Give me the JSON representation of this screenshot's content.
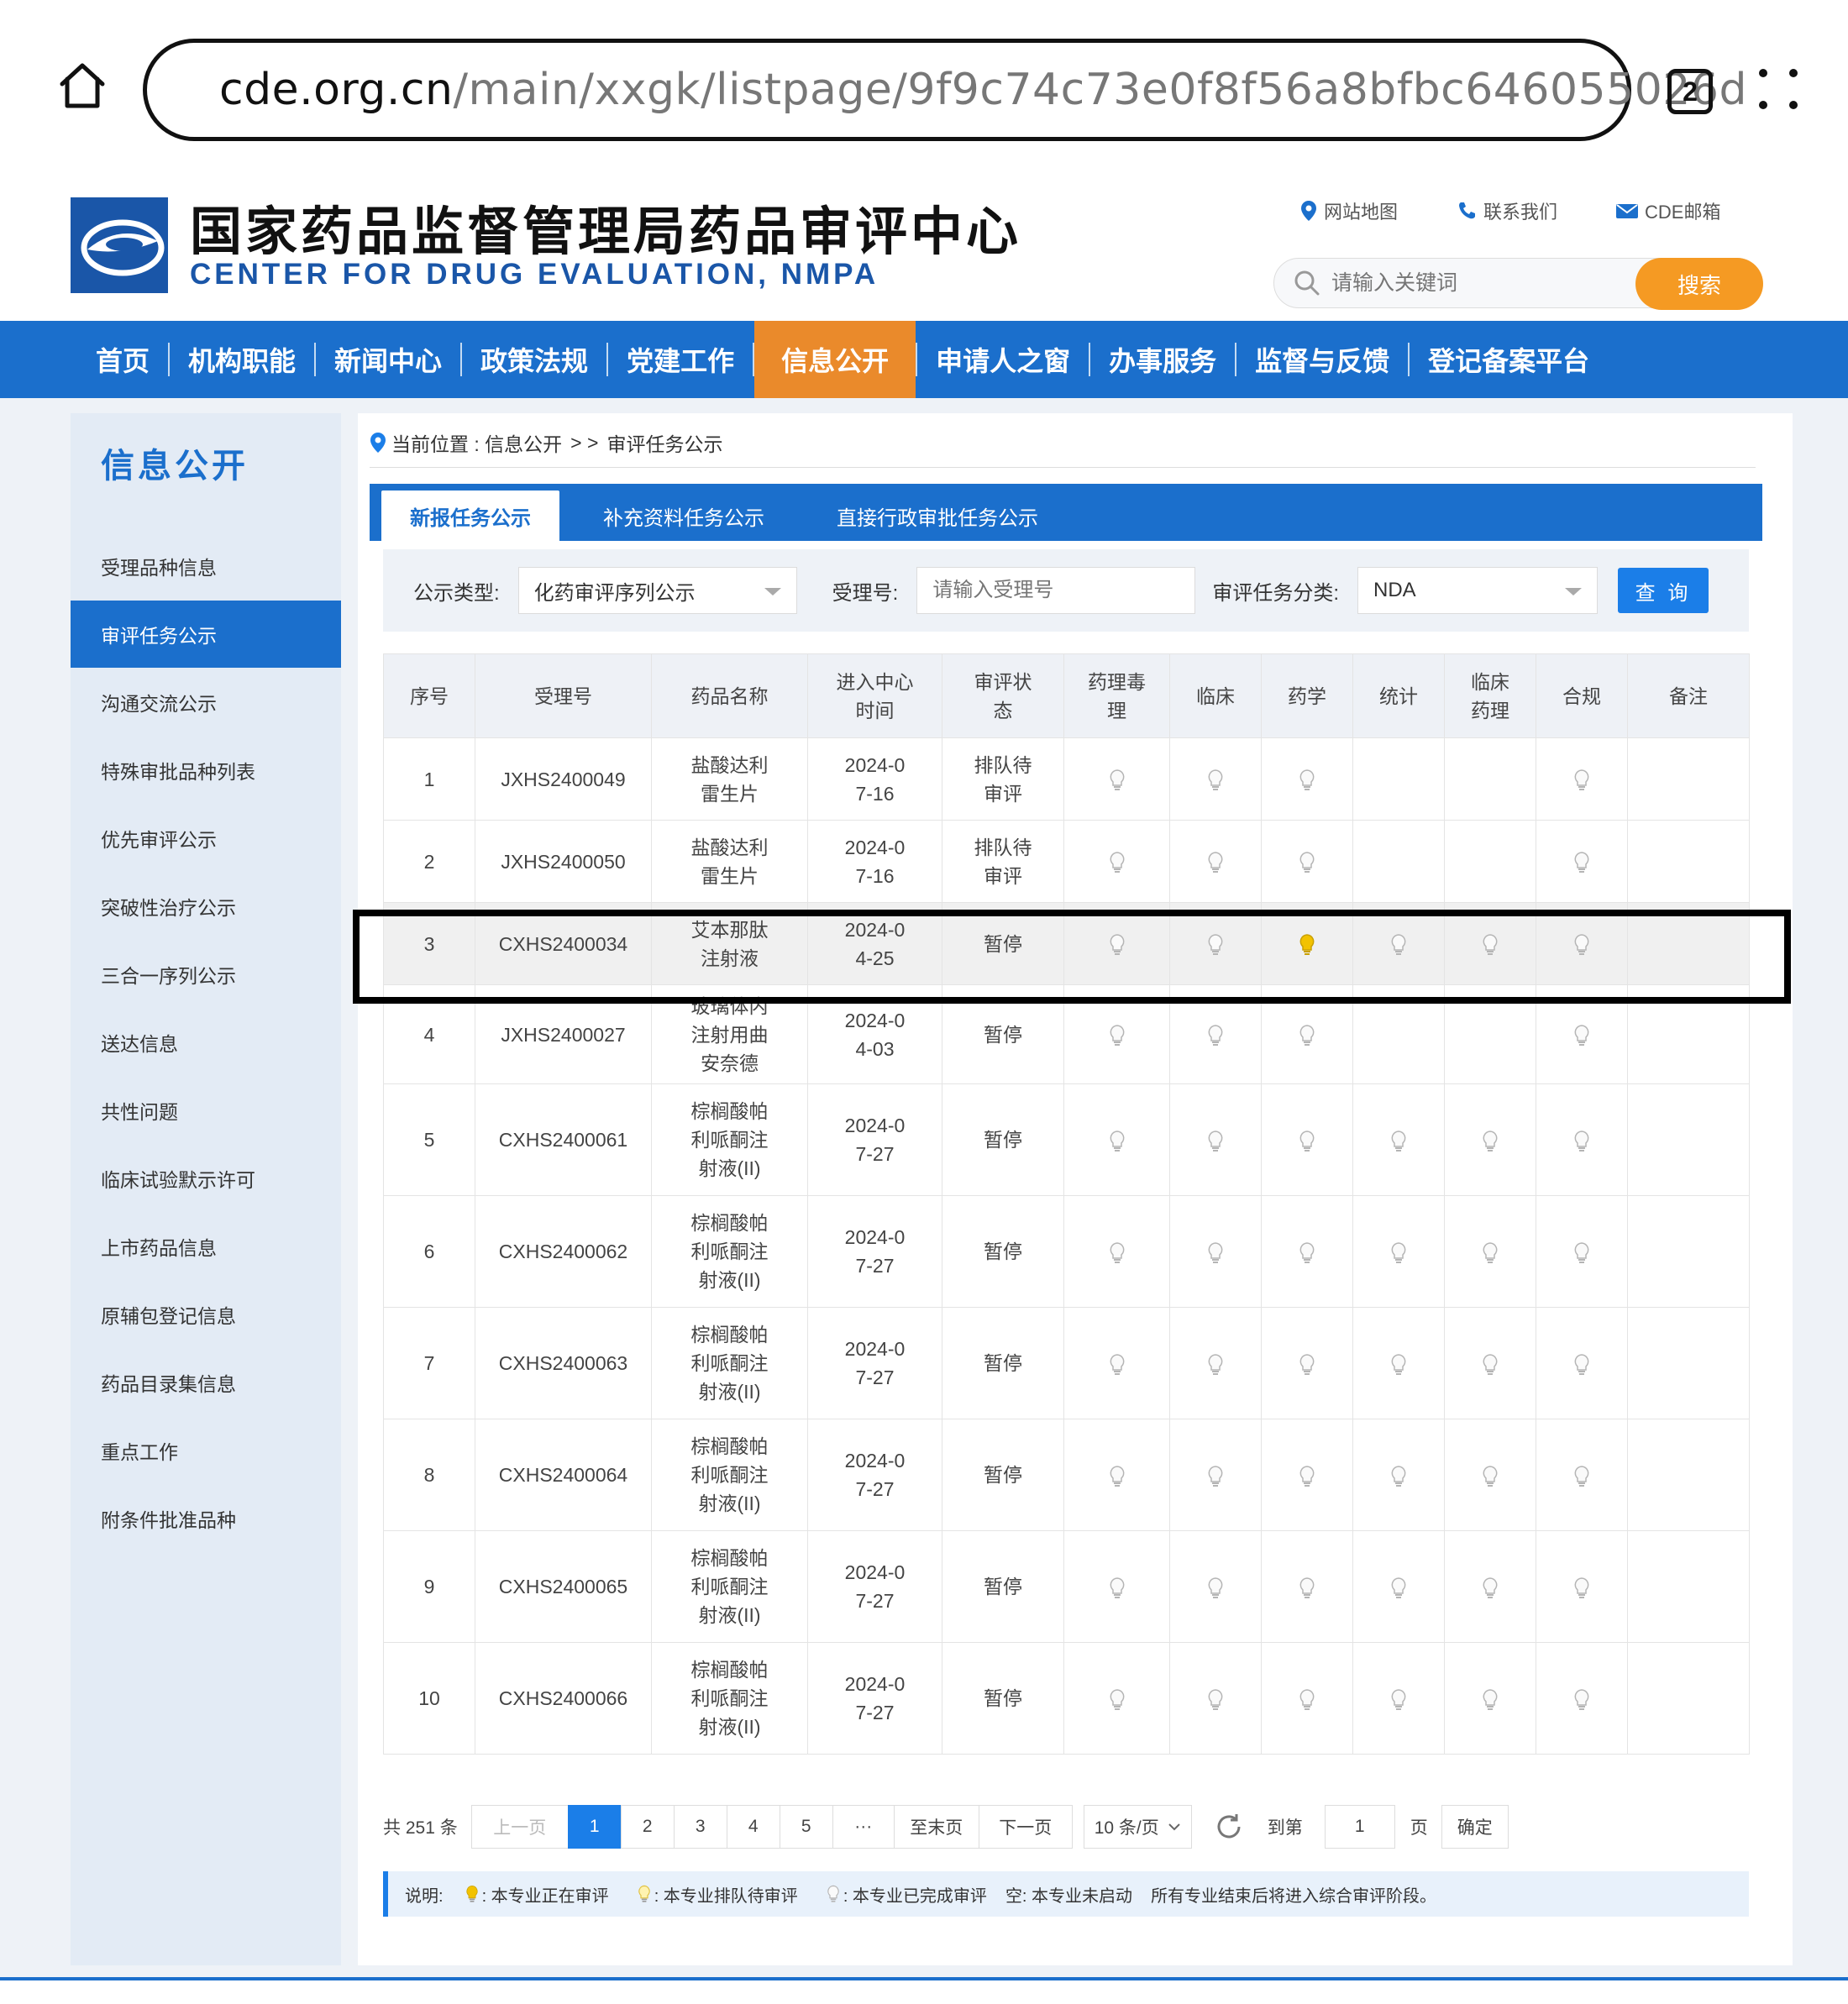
{
  "browser": {
    "url_host": "cde.org.cn",
    "url_path": "/main/xxgk/listpage/9f9c74c73e0f8f56a8bfbc646055026d",
    "tab_count": "2"
  },
  "header": {
    "title": "国家药品监督管理局药品审评中心",
    "subtitle": "CENTER FOR DRUG EVALUATION, NMPA",
    "links": [
      "网站地图",
      "联系我们",
      "CDE邮箱"
    ],
    "search_placeholder": "请输入关键词",
    "search_button": "搜索"
  },
  "nav": {
    "items": [
      "首页",
      "机构职能",
      "新闻中心",
      "政策法规",
      "党建工作",
      "信息公开",
      "申请人之窗",
      "办事服务",
      "监督与反馈",
      "登记备案平台"
    ],
    "active": "信息公开"
  },
  "sidebar": {
    "title": "信息公开",
    "items": [
      "受理品种信息",
      "审评任务公示",
      "沟通交流公示",
      "特殊审批品种列表",
      "优先审评公示",
      "突破性治疗公示",
      "三合一序列公示",
      "送达信息",
      "共性问题",
      "临床试验默示许可",
      "上市药品信息",
      "原辅包登记信息",
      "药品目录集信息",
      "重点工作",
      "附条件批准品种"
    ],
    "active": "审评任务公示"
  },
  "breadcrumb": {
    "prefix": "当前位置 : 信息公开",
    "sep": "> >",
    "current": "审评任务公示"
  },
  "tabs": [
    "新报任务公示",
    "补充资料任务公示",
    "直接行政审批任务公示"
  ],
  "filter": {
    "type_label": "公示类型:",
    "type_value": "化药审评序列公示",
    "accept_label": "受理号:",
    "accept_placeholder": "请输入受理号",
    "category_label": "审评任务分类:",
    "category_value": "NDA",
    "query_button": "查 询"
  },
  "table": {
    "headers": [
      "序号",
      "受理号",
      "药品名称",
      "进入中心时间",
      "审评状态",
      "药理毒理",
      "临床",
      "药学",
      "统计",
      "临床药理",
      "合规",
      "备注"
    ],
    "rows": [
      {
        "no": "1",
        "id": "JXHS2400049",
        "name": "盐酸达利雷生片",
        "date": "2024-07-16",
        "status": "排队待审评",
        "flags": [
          "done",
          "done",
          "done",
          "",
          "",
          "done"
        ],
        "note": ""
      },
      {
        "no": "2",
        "id": "JXHS2400050",
        "name": "盐酸达利雷生片",
        "date": "2024-07-16",
        "status": "排队待审评",
        "flags": [
          "done",
          "done",
          "done",
          "",
          "",
          "done"
        ],
        "note": ""
      },
      {
        "no": "3",
        "id": "CXHS2400034",
        "name": "艾本那肽注射液",
        "date": "2024-04-25",
        "status": "暂停",
        "flags": [
          "done",
          "done",
          "active",
          "done",
          "done",
          "done"
        ],
        "note": ""
      },
      {
        "no": "4",
        "id": "JXHS2400027",
        "name": "玻璃体内注射用曲安奈德",
        "date": "2024-04-03",
        "status": "暂停",
        "flags": [
          "done",
          "done",
          "done",
          "",
          "",
          "done"
        ],
        "note": ""
      },
      {
        "no": "5",
        "id": "CXHS2400061",
        "name": "棕榈酸帕利哌酮注射液(II)",
        "date": "2024-07-27",
        "status": "暂停",
        "flags": [
          "done",
          "done",
          "done",
          "done",
          "done",
          "done"
        ],
        "note": ""
      },
      {
        "no": "6",
        "id": "CXHS2400062",
        "name": "棕榈酸帕利哌酮注射液(II)",
        "date": "2024-07-27",
        "status": "暂停",
        "flags": [
          "done",
          "done",
          "done",
          "done",
          "done",
          "done"
        ],
        "note": ""
      },
      {
        "no": "7",
        "id": "CXHS2400063",
        "name": "棕榈酸帕利哌酮注射液(II)",
        "date": "2024-07-27",
        "status": "暂停",
        "flags": [
          "done",
          "done",
          "done",
          "done",
          "done",
          "done"
        ],
        "note": ""
      },
      {
        "no": "8",
        "id": "CXHS2400064",
        "name": "棕榈酸帕利哌酮注射液(II)",
        "date": "2024-07-27",
        "status": "暂停",
        "flags": [
          "done",
          "done",
          "done",
          "done",
          "done",
          "done"
        ],
        "note": ""
      },
      {
        "no": "9",
        "id": "CXHS2400065",
        "name": "棕榈酸帕利哌酮注射液(II)",
        "date": "2024-07-27",
        "status": "暂停",
        "flags": [
          "done",
          "done",
          "done",
          "done",
          "done",
          "done"
        ],
        "note": ""
      },
      {
        "no": "10",
        "id": "CXHS2400066",
        "name": "棕榈酸帕利哌酮注射液(II)",
        "date": "2024-07-27",
        "status": "暂停",
        "flags": [
          "done",
          "done",
          "done",
          "done",
          "done",
          "done"
        ],
        "note": ""
      }
    ]
  },
  "pager": {
    "total": "共 251 条",
    "prev": "上一页",
    "pages": [
      "1",
      "2",
      "3",
      "4",
      "5",
      "···"
    ],
    "current": "1",
    "last": "至末页",
    "next": "下一页",
    "size": "10 条/页",
    "goto_label": "到第",
    "goto_value": "1",
    "page_label": "页",
    "confirm": "确定"
  },
  "legend": {
    "title": "说明:",
    "active": ": 本专业正在审评",
    "queued": ": 本专业排队待审评",
    "done": ": 本专业已完成审评",
    "empty": "空: 本专业未启动",
    "note": "所有专业结束后将进入综合审评阶段。"
  },
  "colors": {
    "brand_blue": "#1b6fcc",
    "nav_active": "#ea8a2b",
    "search_button": "#f59a23",
    "bulb_active": "#f2c200",
    "bulb_done": "#bdbdbd"
  }
}
